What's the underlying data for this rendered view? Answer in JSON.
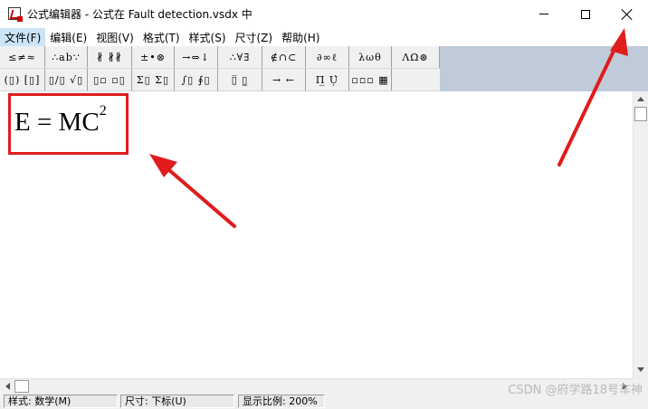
{
  "window": {
    "title": "公式编辑器 - 公式在 Fault detection.vsdx 中",
    "icon": "equation-editor-icon",
    "controls": [
      "minimize-icon",
      "maximize-icon",
      "close-icon"
    ]
  },
  "menu": [
    {
      "label": "文件(F)",
      "active": true
    },
    {
      "label": "编辑(E)"
    },
    {
      "label": "视图(V)"
    },
    {
      "label": "格式(T)"
    },
    {
      "label": "样式(S)"
    },
    {
      "label": "尺寸(Z)"
    },
    {
      "label": "帮助(H)"
    }
  ],
  "toolbar": {
    "row1": [
      "≤≠≈",
      "∴ab∵",
      "∦ ∦∦",
      "±•⊗",
      "→⇔↓",
      "∴∀∃",
      "∉∩⊂",
      "∂∞ℓ",
      "λωθ",
      "ΛΩ⊛"
    ],
    "row2": [
      "(▯) [▯]",
      "▯/▯ √▯",
      "▯▫ ▫▯",
      "Σ▯ Σ▯",
      "∫▯ ∮▯",
      "▯̅ ▯̲",
      "→ ←",
      "Π̲ Ụ̇",
      "▫▫▫ ▦"
    ]
  },
  "editor": {
    "equation": {
      "base": "E = MC",
      "superscript": "2"
    }
  },
  "status": {
    "style": "样式: 数学(M)",
    "size": "尺寸: 下标(U)",
    "zoom": "显示比例: 200%"
  },
  "watermark": "CSDN @府学路18号车神",
  "colors": {
    "annotation": "#e01c1c",
    "toolbar_bg": "#bfcbd9"
  }
}
